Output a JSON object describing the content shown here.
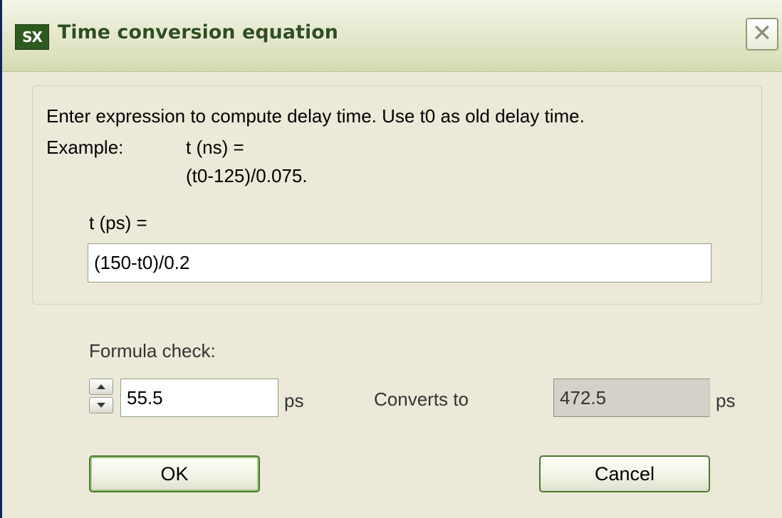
{
  "window": {
    "title": "Time conversion equation",
    "icon_text": "SX",
    "close_glyph": "✕"
  },
  "instructions": {
    "line1": "Enter expression to compute delay time. Use t0 as old delay time.",
    "example_label": "Example:",
    "example_lhs": "t (ns) =",
    "example_rhs": "(t0-125)/0.075."
  },
  "expression": {
    "label": "t (ps) =",
    "value": "(150-t0)/0.2"
  },
  "formula_check": {
    "label": "Formula check:",
    "input_value": "55.5",
    "input_unit": "ps",
    "converts_label": "Converts to",
    "result_value": "472.5",
    "result_unit": "ps"
  },
  "buttons": {
    "ok_label": "OK",
    "cancel_label": "Cancel"
  },
  "colors": {
    "window_bg": "#ece9d8",
    "title_text": "#2f4f1f",
    "button_border": "#4a7a2c",
    "readonly_bg": "#d4d2c8"
  },
  "icons": {
    "app": "sx-app-icon",
    "close": "close-icon",
    "spin_up": "triangle-up-icon",
    "spin_down": "triangle-down-icon"
  }
}
